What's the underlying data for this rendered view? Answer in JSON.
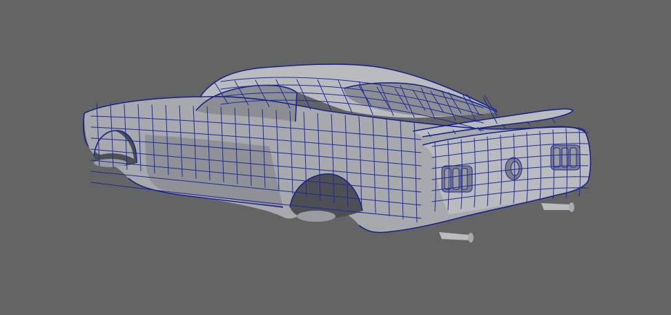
{
  "viewport": {
    "background_color": "#646464",
    "wireframe_color": "#1c2a9c",
    "surface_color": "#a7a9ad",
    "render_mode": "wireframe-on-shaded"
  },
  "model": {
    "icon": "car-model-icon"
  }
}
